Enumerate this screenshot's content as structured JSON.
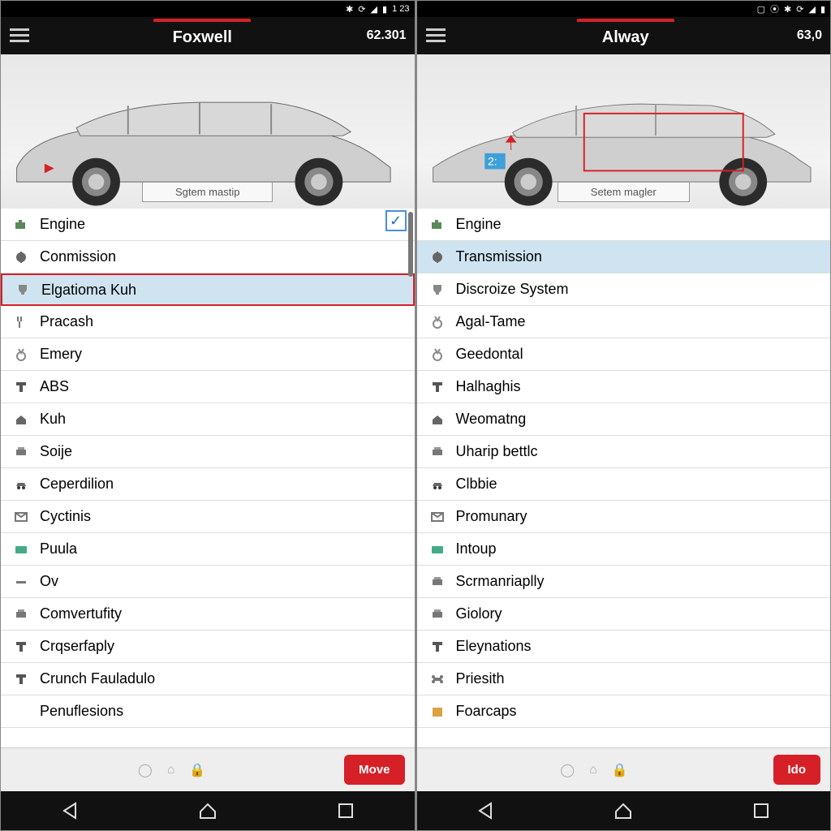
{
  "status": {
    "time": "1 23",
    "icons": [
      "bt",
      "sync",
      "wifi",
      "batt"
    ],
    "icons_right": [
      "sq",
      "sync",
      "batt"
    ]
  },
  "left": {
    "title": "Foxwell",
    "number": "62.301",
    "diag_label": "Sgtem mastip",
    "items": [
      {
        "icon": "engine",
        "label": "Engine"
      },
      {
        "icon": "ctrl",
        "label": "Conmission"
      },
      {
        "icon": "trophy",
        "label": "Elgatioma Kuh"
      },
      {
        "icon": "fork",
        "label": "Pracash"
      },
      {
        "icon": "medal",
        "label": "Emery"
      },
      {
        "icon": "tee",
        "label": "ABS"
      },
      {
        "icon": "house",
        "label": "Kuh"
      },
      {
        "icon": "printer",
        "label": "Soije"
      },
      {
        "icon": "car",
        "label": "Ceperdilion"
      },
      {
        "icon": "mail",
        "label": "Cyctinis"
      },
      {
        "icon": "card",
        "label": "Puula"
      },
      {
        "icon": "dash",
        "label": "Ov"
      },
      {
        "icon": "printer",
        "label": "Comvertufity"
      },
      {
        "icon": "tee",
        "label": "Crqserfaply"
      },
      {
        "icon": "tee",
        "label": "Crunch Fauladulo"
      },
      {
        "icon": "blank",
        "label": "Penuflesions"
      }
    ],
    "selected_index": 2,
    "checked": true,
    "footer_button": "Move"
  },
  "right": {
    "title": "Alway",
    "number": "63,0",
    "diag_label": "Setem magler",
    "marker_value": "2:",
    "items": [
      {
        "icon": "engine",
        "label": "Engine"
      },
      {
        "icon": "ctrl",
        "label": "Transmission"
      },
      {
        "icon": "trophy",
        "label": "Discroize System"
      },
      {
        "icon": "medal",
        "label": "Agal-Tame"
      },
      {
        "icon": "medal",
        "label": "Geedontal"
      },
      {
        "icon": "tee",
        "label": "Halhaghis"
      },
      {
        "icon": "house",
        "label": "Weomatng"
      },
      {
        "icon": "printer",
        "label": "Uharip bettlc"
      },
      {
        "icon": "car",
        "label": "Clbbie"
      },
      {
        "icon": "mail",
        "label": "Promunary"
      },
      {
        "icon": "card",
        "label": "Intoup"
      },
      {
        "icon": "printer",
        "label": "Scrmanriaplly"
      },
      {
        "icon": "printer",
        "label": "Giolory"
      },
      {
        "icon": "tee",
        "label": "Eleynations"
      },
      {
        "icon": "bone",
        "label": "Priesith"
      },
      {
        "icon": "box",
        "label": "Foarcaps"
      }
    ],
    "selected_index": 1,
    "footer_button": "Ido"
  },
  "colors": {
    "accent": "#d62027",
    "selected_bg": "#cfe4f0",
    "bar": "#111111"
  }
}
